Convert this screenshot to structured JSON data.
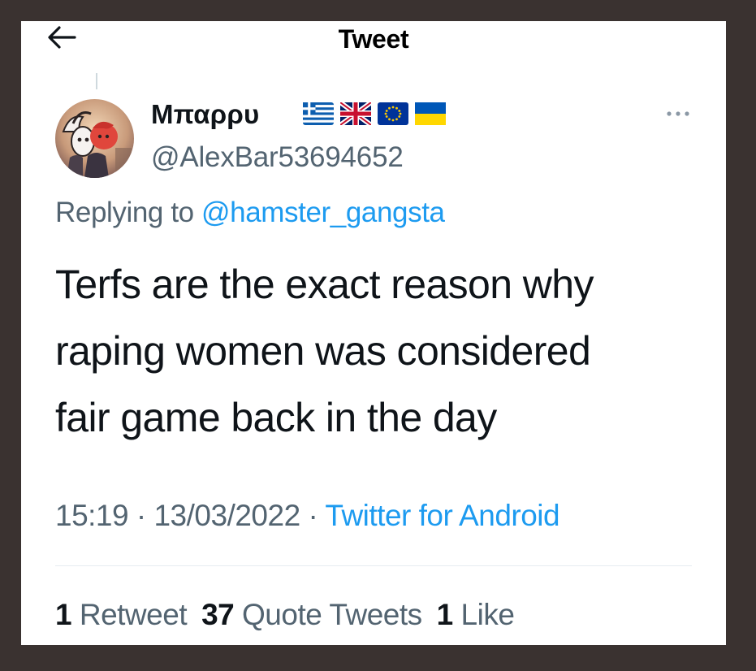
{
  "header": {
    "title": "Tweet",
    "back_icon": "back-arrow-icon"
  },
  "tweet": {
    "display_name": "Μπαρρυ",
    "flags": [
      "flag-greece",
      "flag-uk",
      "flag-eu",
      "flag-ukraine"
    ],
    "handle": "@AlexBar53694652",
    "more_icon": "more-dots-icon",
    "replying_prefix": "Replying to",
    "replying_to": "@hamster_gangsta",
    "text_lines": [
      "Terfs are the exact reason why",
      "raping women was considered",
      "fair game back in the day"
    ],
    "time": "15:19",
    "separator": "·",
    "date": "13/03/2022",
    "source": "Twitter for Android"
  },
  "stats": {
    "retweets_count": "1",
    "retweets_label": "Retweet",
    "quotes_count": "37",
    "quotes_label": "Quote Tweets",
    "likes_count": "1",
    "likes_label": "Like"
  },
  "colors": {
    "link_blue": "#1d9bf0",
    "secondary_text": "#536471",
    "primary_text": "#0f1419",
    "background_frame": "#3a3230"
  }
}
